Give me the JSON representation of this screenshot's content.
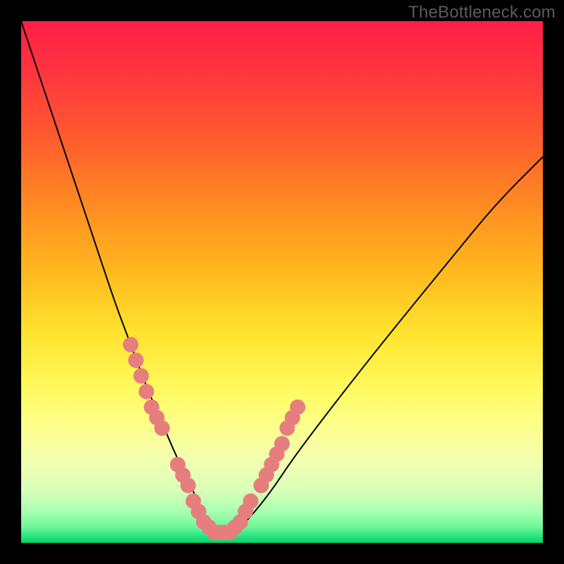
{
  "watermark_text": "TheBottleneck.com",
  "colors": {
    "frame_bg": "#000000",
    "curve_stroke": "#000000",
    "dot_fill": "#e77e7e",
    "gradient_top": "#ff1f46",
    "gradient_bottom": "#00d46a"
  },
  "chart_data": {
    "type": "line",
    "title": "",
    "xlabel": "",
    "ylabel": "",
    "xlim": [
      0,
      100
    ],
    "ylim": [
      0,
      100
    ],
    "grid": false,
    "legend": false,
    "note": "Axes have no visible tick labels. x/y values are read as percentages of the plot area (origin bottom-left). The curve is a V-shaped bottleneck profile with its minimum near x≈37.",
    "series": [
      {
        "name": "bottleneck-curve",
        "x": [
          0,
          3,
          6,
          9,
          12,
          15,
          18,
          21,
          24,
          27,
          30,
          33,
          35,
          37,
          39,
          41,
          44,
          48,
          52,
          58,
          65,
          73,
          82,
          91,
          100
        ],
        "y": [
          100,
          91,
          82,
          73,
          64,
          55,
          46,
          38,
          30,
          23,
          16,
          10,
          5,
          2,
          1,
          2,
          5,
          10,
          16,
          24,
          33,
          43,
          54,
          65,
          74
        ]
      }
    ],
    "highlight_points": {
      "name": "pink-markers",
      "note": "Clustered dots near the curve trough and partway up each arm.",
      "points": [
        {
          "x": 21,
          "y": 38
        },
        {
          "x": 22,
          "y": 35
        },
        {
          "x": 23,
          "y": 32
        },
        {
          "x": 24,
          "y": 29
        },
        {
          "x": 25,
          "y": 26
        },
        {
          "x": 26,
          "y": 24
        },
        {
          "x": 27,
          "y": 22
        },
        {
          "x": 30,
          "y": 15
        },
        {
          "x": 31,
          "y": 13
        },
        {
          "x": 32,
          "y": 11
        },
        {
          "x": 33,
          "y": 8
        },
        {
          "x": 34,
          "y": 6
        },
        {
          "x": 35,
          "y": 4
        },
        {
          "x": 36,
          "y": 3
        },
        {
          "x": 37,
          "y": 2
        },
        {
          "x": 38,
          "y": 2
        },
        {
          "x": 39,
          "y": 2
        },
        {
          "x": 40,
          "y": 2
        },
        {
          "x": 41,
          "y": 3
        },
        {
          "x": 42,
          "y": 4
        },
        {
          "x": 43,
          "y": 6
        },
        {
          "x": 44,
          "y": 8
        },
        {
          "x": 46,
          "y": 11
        },
        {
          "x": 47,
          "y": 13
        },
        {
          "x": 48,
          "y": 15
        },
        {
          "x": 49,
          "y": 17
        },
        {
          "x": 50,
          "y": 19
        },
        {
          "x": 51,
          "y": 22
        },
        {
          "x": 52,
          "y": 24
        },
        {
          "x": 53,
          "y": 26
        }
      ]
    }
  }
}
